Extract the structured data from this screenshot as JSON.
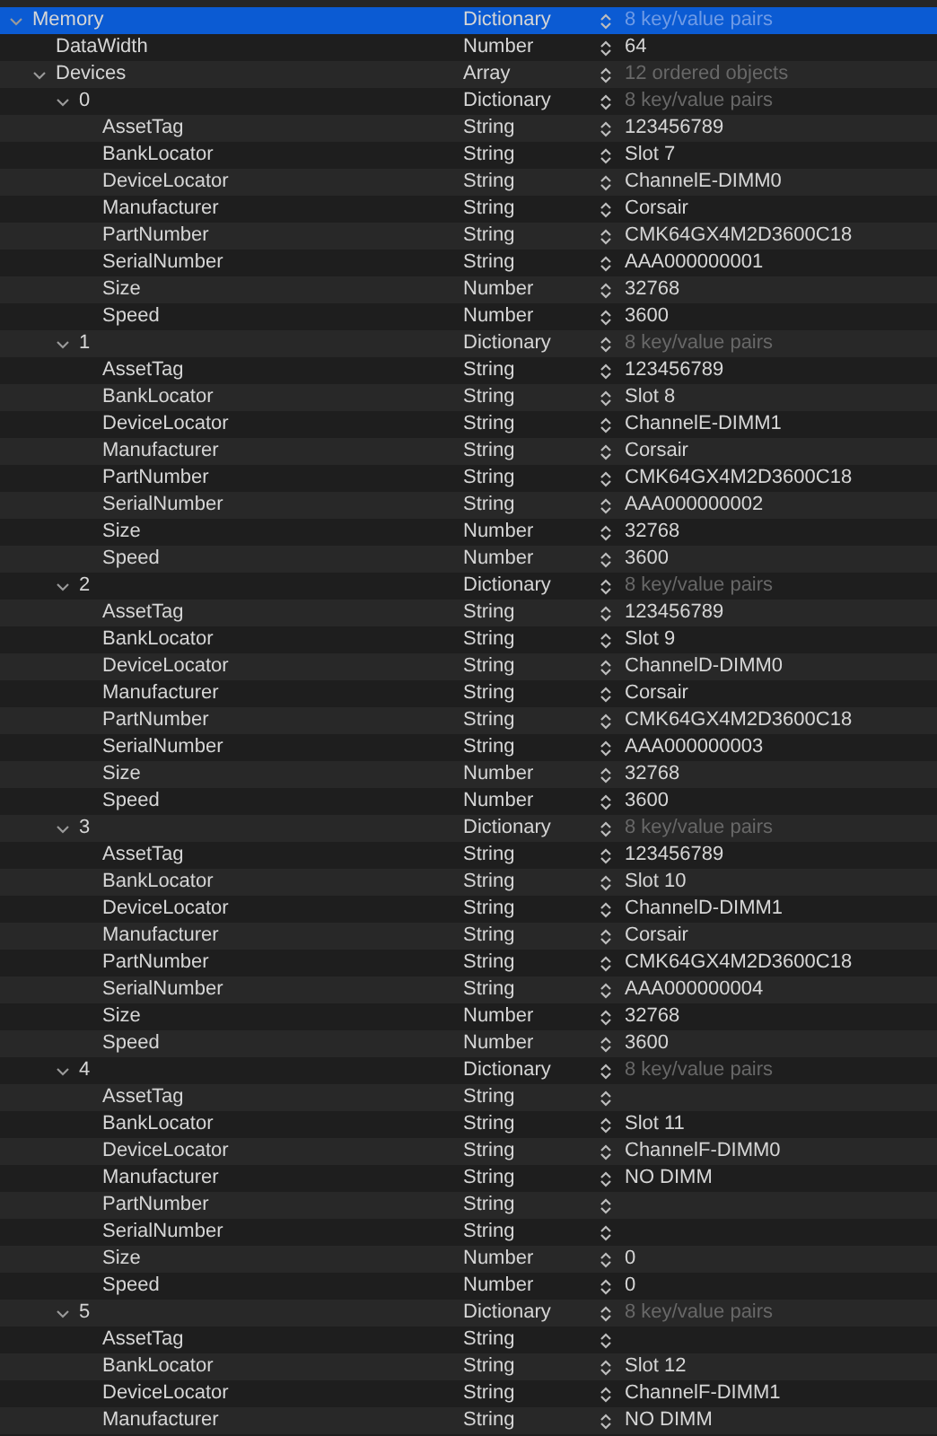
{
  "rows": [
    {
      "key": "Memory",
      "type": "Dictionary",
      "summary": "8 key/value pairs",
      "expanded": true,
      "selected": true,
      "children": [
        {
          "key": "DataWidth",
          "type": "Number",
          "value": "64",
          "selected": false
        },
        {
          "key": "Devices",
          "type": "Array",
          "summary": "12 ordered objects",
          "expanded": true,
          "selected": false,
          "children": [
            {
              "key": "0",
              "type": "Dictionary",
              "summary": "8 key/value pairs",
              "expanded": true,
              "selected": false,
              "children": [
                {
                  "key": "AssetTag",
                  "type": "String",
                  "value": "123456789",
                  "selected": false
                },
                {
                  "key": "BankLocator",
                  "type": "String",
                  "value": "Slot 7",
                  "selected": false
                },
                {
                  "key": "DeviceLocator",
                  "type": "String",
                  "value": "ChannelE-DIMM0",
                  "selected": false
                },
                {
                  "key": "Manufacturer",
                  "type": "String",
                  "value": "Corsair",
                  "selected": false
                },
                {
                  "key": "PartNumber",
                  "type": "String",
                  "value": "CMK64GX4M2D3600C18",
                  "selected": false
                },
                {
                  "key": "SerialNumber",
                  "type": "String",
                  "value": "AAA000000001",
                  "selected": false
                },
                {
                  "key": "Size",
                  "type": "Number",
                  "value": "32768",
                  "selected": false
                },
                {
                  "key": "Speed",
                  "type": "Number",
                  "value": "3600",
                  "selected": false
                }
              ]
            },
            {
              "key": "1",
              "type": "Dictionary",
              "summary": "8 key/value pairs",
              "expanded": true,
              "selected": false,
              "children": [
                {
                  "key": "AssetTag",
                  "type": "String",
                  "value": "123456789",
                  "selected": false
                },
                {
                  "key": "BankLocator",
                  "type": "String",
                  "value": "Slot 8",
                  "selected": false
                },
                {
                  "key": "DeviceLocator",
                  "type": "String",
                  "value": "ChannelE-DIMM1",
                  "selected": false
                },
                {
                  "key": "Manufacturer",
                  "type": "String",
                  "value": "Corsair",
                  "selected": false
                },
                {
                  "key": "PartNumber",
                  "type": "String",
                  "value": "CMK64GX4M2D3600C18",
                  "selected": false
                },
                {
                  "key": "SerialNumber",
                  "type": "String",
                  "value": "AAA000000002",
                  "selected": false
                },
                {
                  "key": "Size",
                  "type": "Number",
                  "value": "32768",
                  "selected": false
                },
                {
                  "key": "Speed",
                  "type": "Number",
                  "value": "3600",
                  "selected": false
                }
              ]
            },
            {
              "key": "2",
              "type": "Dictionary",
              "summary": "8 key/value pairs",
              "expanded": true,
              "selected": false,
              "children": [
                {
                  "key": "AssetTag",
                  "type": "String",
                  "value": "123456789",
                  "selected": false
                },
                {
                  "key": "BankLocator",
                  "type": "String",
                  "value": "Slot 9",
                  "selected": false
                },
                {
                  "key": "DeviceLocator",
                  "type": "String",
                  "value": "ChannelD-DIMM0",
                  "selected": false
                },
                {
                  "key": "Manufacturer",
                  "type": "String",
                  "value": "Corsair",
                  "selected": false
                },
                {
                  "key": "PartNumber",
                  "type": "String",
                  "value": "CMK64GX4M2D3600C18",
                  "selected": false
                },
                {
                  "key": "SerialNumber",
                  "type": "String",
                  "value": "AAA000000003",
                  "selected": false
                },
                {
                  "key": "Size",
                  "type": "Number",
                  "value": "32768",
                  "selected": false
                },
                {
                  "key": "Speed",
                  "type": "Number",
                  "value": "3600",
                  "selected": false
                }
              ]
            },
            {
              "key": "3",
              "type": "Dictionary",
              "summary": "8 key/value pairs",
              "expanded": true,
              "selected": false,
              "children": [
                {
                  "key": "AssetTag",
                  "type": "String",
                  "value": "123456789",
                  "selected": false
                },
                {
                  "key": "BankLocator",
                  "type": "String",
                  "value": "Slot 10",
                  "selected": false
                },
                {
                  "key": "DeviceLocator",
                  "type": "String",
                  "value": "ChannelD-DIMM1",
                  "selected": false
                },
                {
                  "key": "Manufacturer",
                  "type": "String",
                  "value": "Corsair",
                  "selected": false
                },
                {
                  "key": "PartNumber",
                  "type": "String",
                  "value": "CMK64GX4M2D3600C18",
                  "selected": false
                },
                {
                  "key": "SerialNumber",
                  "type": "String",
                  "value": "AAA000000004",
                  "selected": false
                },
                {
                  "key": "Size",
                  "type": "Number",
                  "value": "32768",
                  "selected": false
                },
                {
                  "key": "Speed",
                  "type": "Number",
                  "value": "3600",
                  "selected": false
                }
              ]
            },
            {
              "key": "4",
              "type": "Dictionary",
              "summary": "8 key/value pairs",
              "expanded": true,
              "selected": false,
              "children": [
                {
                  "key": "AssetTag",
                  "type": "String",
                  "selected": false
                },
                {
                  "key": "BankLocator",
                  "type": "String",
                  "value": "Slot 11",
                  "selected": false
                },
                {
                  "key": "DeviceLocator",
                  "type": "String",
                  "value": "ChannelF-DIMM0",
                  "selected": false
                },
                {
                  "key": "Manufacturer",
                  "type": "String",
                  "value": "NO DIMM",
                  "selected": false
                },
                {
                  "key": "PartNumber",
                  "type": "String",
                  "selected": false
                },
                {
                  "key": "SerialNumber",
                  "type": "String",
                  "selected": false
                },
                {
                  "key": "Size",
                  "type": "Number",
                  "value": "0",
                  "selected": false
                },
                {
                  "key": "Speed",
                  "type": "Number",
                  "value": "0",
                  "selected": false
                }
              ]
            },
            {
              "key": "5",
              "type": "Dictionary",
              "summary": "8 key/value pairs",
              "expanded": true,
              "selected": false,
              "children": [
                {
                  "key": "AssetTag",
                  "type": "String",
                  "selected": false
                },
                {
                  "key": "BankLocator",
                  "type": "String",
                  "value": "Slot 12",
                  "selected": false
                },
                {
                  "key": "DeviceLocator",
                  "type": "String",
                  "value": "ChannelF-DIMM1",
                  "selected": false
                },
                {
                  "key": "Manufacturer",
                  "type": "String",
                  "value": "NO DIMM",
                  "selected": false
                }
              ]
            }
          ]
        }
      ]
    }
  ]
}
